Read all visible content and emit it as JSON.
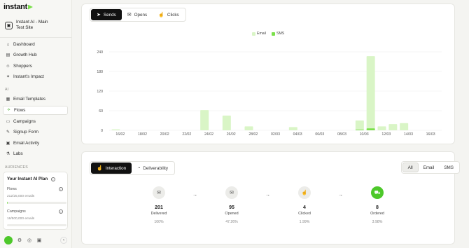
{
  "brand": {
    "name": "instant"
  },
  "site": {
    "name_line1": "Instant AI - Main",
    "name_line2": "Test Site"
  },
  "nav": {
    "items": [
      {
        "label": "Dashboard",
        "icon": "grid-icon"
      },
      {
        "label": "Growth Hub",
        "icon": "chart-icon"
      },
      {
        "label": "Shoppers",
        "icon": "users-icon"
      },
      {
        "label": "Instant's Impact",
        "icon": "spark-icon"
      }
    ],
    "ai_label": "AI",
    "ai_items": [
      {
        "label": "Email Templates",
        "icon": "template-icon"
      },
      {
        "label": "Flows",
        "icon": "flow-icon",
        "active": true
      },
      {
        "label": "Campaigns",
        "icon": "megaphone-icon"
      },
      {
        "label": "Signup Form",
        "icon": "form-icon"
      },
      {
        "label": "Email Activity",
        "icon": "activity-icon"
      },
      {
        "label": "Labs",
        "icon": "flask-icon"
      }
    ],
    "audiences_label": "AUDIENCES"
  },
  "plan": {
    "title": "Your Instant AI Plan",
    "flows_label": "Flows",
    "flows_value": "212/25,000 emails",
    "flows_progress": 0.01,
    "campaigns_label": "Campaigns",
    "campaigns_value": "16/500,000 emails",
    "campaigns_progress": 0.0
  },
  "top_tabs": [
    {
      "label": "Sends",
      "icon": "send-icon",
      "selected": true
    },
    {
      "label": "Opens",
      "icon": "envelope-open-icon",
      "selected": false
    },
    {
      "label": "Clicks",
      "icon": "cursor-click-icon",
      "selected": false
    }
  ],
  "colors": {
    "email": "#d9f5c6",
    "sms": "#7be04b",
    "accent": "#4dc82a"
  },
  "chart_data": {
    "type": "bar",
    "legend": [
      "Email",
      "SMS"
    ],
    "legend_placement": "top-center",
    "ylim": [
      0,
      240
    ],
    "yticks": [
      "0",
      "60",
      "120",
      "180",
      "240"
    ],
    "xticks": [
      "16/02",
      "18/02",
      "20/02",
      "22/02",
      "24/02",
      "26/02",
      "28/02",
      "02/03",
      "04/03",
      "06/03",
      "08/03",
      "10/03",
      "12/03",
      "14/03",
      "16/03"
    ],
    "grid": true,
    "series": [
      {
        "name": "Email",
        "points": [
          [
            0.3,
            3
          ],
          [
            4.3,
            62
          ],
          [
            5.3,
            45
          ],
          [
            6.3,
            12
          ],
          [
            8.3,
            10
          ],
          [
            11.3,
            30
          ],
          [
            11.8,
            227
          ],
          [
            12.3,
            12
          ],
          [
            12.8,
            19
          ],
          [
            13.3,
            22
          ]
        ]
      },
      {
        "name": "SMS",
        "points": [
          [
            11.3,
            2
          ],
          [
            11.8,
            6
          ]
        ]
      }
    ]
  },
  "bottom_tabs": [
    {
      "label": "Interaction",
      "icon": "cursor-click-icon",
      "selected": true
    },
    {
      "label": "Deliverability",
      "icon": "gauge-icon",
      "selected": false
    }
  ],
  "filter_tabs": [
    {
      "label": "All",
      "selected": true
    },
    {
      "label": "Email",
      "selected": false
    },
    {
      "label": "SMS",
      "selected": false
    }
  ],
  "funnel": [
    {
      "value": "201",
      "label": "Delivered",
      "pct": "100%",
      "icon": "envelope-icon"
    },
    {
      "value": "95",
      "label": "Opened",
      "pct": "47.26%",
      "icon": "envelope-open-icon"
    },
    {
      "value": "4",
      "label": "Clicked",
      "pct": "1.99%",
      "icon": "cursor-click-icon"
    },
    {
      "value": "8",
      "label": "Ordered",
      "pct": "3.98%",
      "icon": "cart-icon"
    }
  ]
}
